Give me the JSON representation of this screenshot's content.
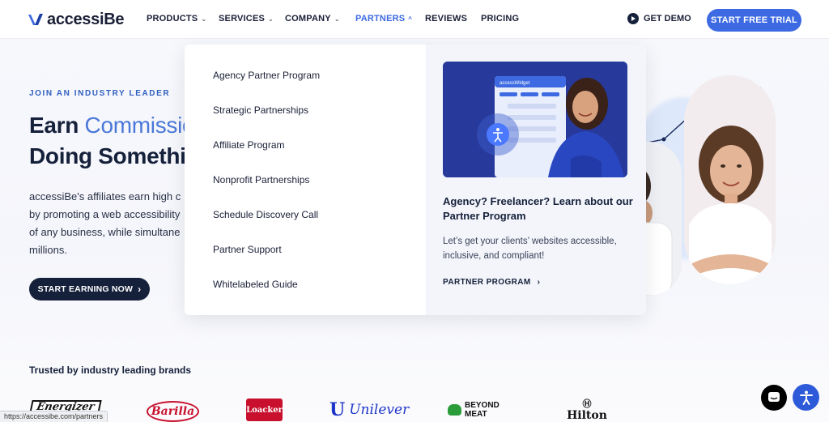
{
  "nav": {
    "logo_text": "accessiBe",
    "items": [
      {
        "label": "PRODUCTS",
        "has_dropdown": true
      },
      {
        "label": "SERVICES",
        "has_dropdown": true
      },
      {
        "label": "COMPANY",
        "has_dropdown": true
      },
      {
        "label": "PARTNERS",
        "has_dropdown": true,
        "active": true
      },
      {
        "label": "REVIEWS",
        "has_dropdown": false
      },
      {
        "label": "PRICING",
        "has_dropdown": false
      }
    ],
    "get_demo": "GET DEMO",
    "trial_button": "START FREE TRIAL",
    "accent_color": "#3d6ae3"
  },
  "hero": {
    "kicker": "JOIN AN INDUSTRY LEADER",
    "title_line1_a": "Earn ",
    "title_line1_b": "Commissio",
    "title_line2": "Doing Somethi",
    "paragraph_lines": [
      "accessiBe's affiliates earn high c",
      "by promoting a web accessibility",
      "of any business, while simultane",
      "millions."
    ],
    "cta": "START EARNING NOW"
  },
  "partners_menu": {
    "items": [
      "Agency Partner Program",
      "Strategic Partnerships",
      "Affiliate Program",
      "Nonprofit Partnerships",
      "Schedule Discovery Call",
      "Partner Support",
      "Whitelabeled Guide"
    ],
    "promo": {
      "image_label": "accessWidget",
      "title": "Agency? Freelancer? Learn about our Partner Program",
      "text": "Let’s get your clients’ websites accessible, inclusive, and compliant!",
      "link": "PARTNER PROGRAM"
    }
  },
  "trusted": {
    "heading": "Trusted by industry leading brands",
    "brands": [
      "Energizer",
      "Barilla",
      "Loacker",
      "Unilever",
      "BEYOND MEAT",
      "Hilton"
    ]
  },
  "status_bar": {
    "url": "https://accessibe.com/partners"
  },
  "widgets": {
    "chat_icon": "chat-bubble-icon",
    "accessibility_icon": "accessibility-person-icon"
  }
}
